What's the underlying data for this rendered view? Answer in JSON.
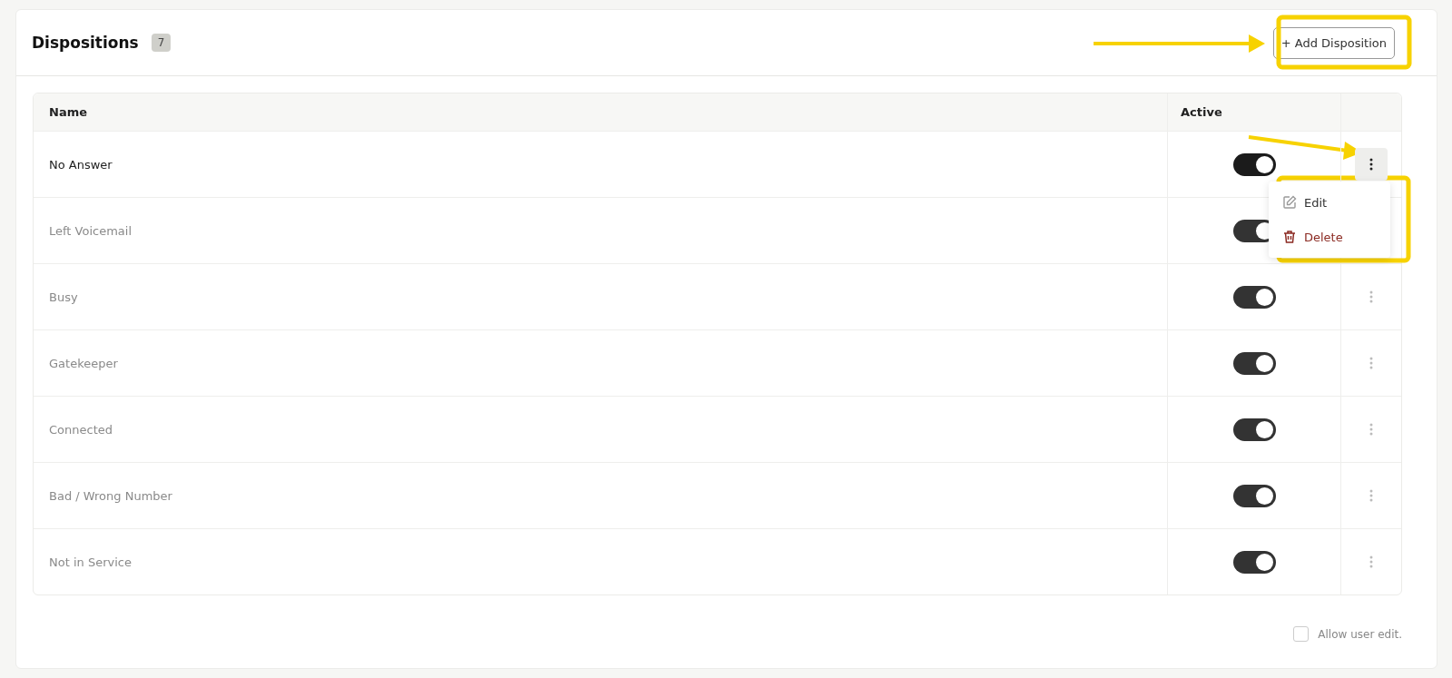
{
  "header": {
    "title": "Dispositions",
    "count": "7",
    "add_button": "+ Add Disposition"
  },
  "table": {
    "columns": [
      "Name",
      "Active"
    ],
    "rows": [
      {
        "name": "No Answer",
        "on": true,
        "menu_open": true
      },
      {
        "name": "Left Voicemail",
        "on": true,
        "menu_open": false
      },
      {
        "name": "Busy",
        "on": true,
        "menu_open": false
      },
      {
        "name": "Gatekeeper",
        "on": true,
        "menu_open": false
      },
      {
        "name": "Connected",
        "on": true,
        "menu_open": false
      },
      {
        "name": "Bad / Wrong Number",
        "on": true,
        "menu_open": false
      },
      {
        "name": "Not in Service",
        "on": true,
        "menu_open": false
      }
    ]
  },
  "row_menu": {
    "items": [
      {
        "label": "Edit",
        "kind": "edit"
      },
      {
        "label": "Delete",
        "kind": "delete"
      }
    ]
  },
  "footer": {
    "allow_user_edit": {
      "label": "Allow user edit.",
      "checked": false
    }
  }
}
